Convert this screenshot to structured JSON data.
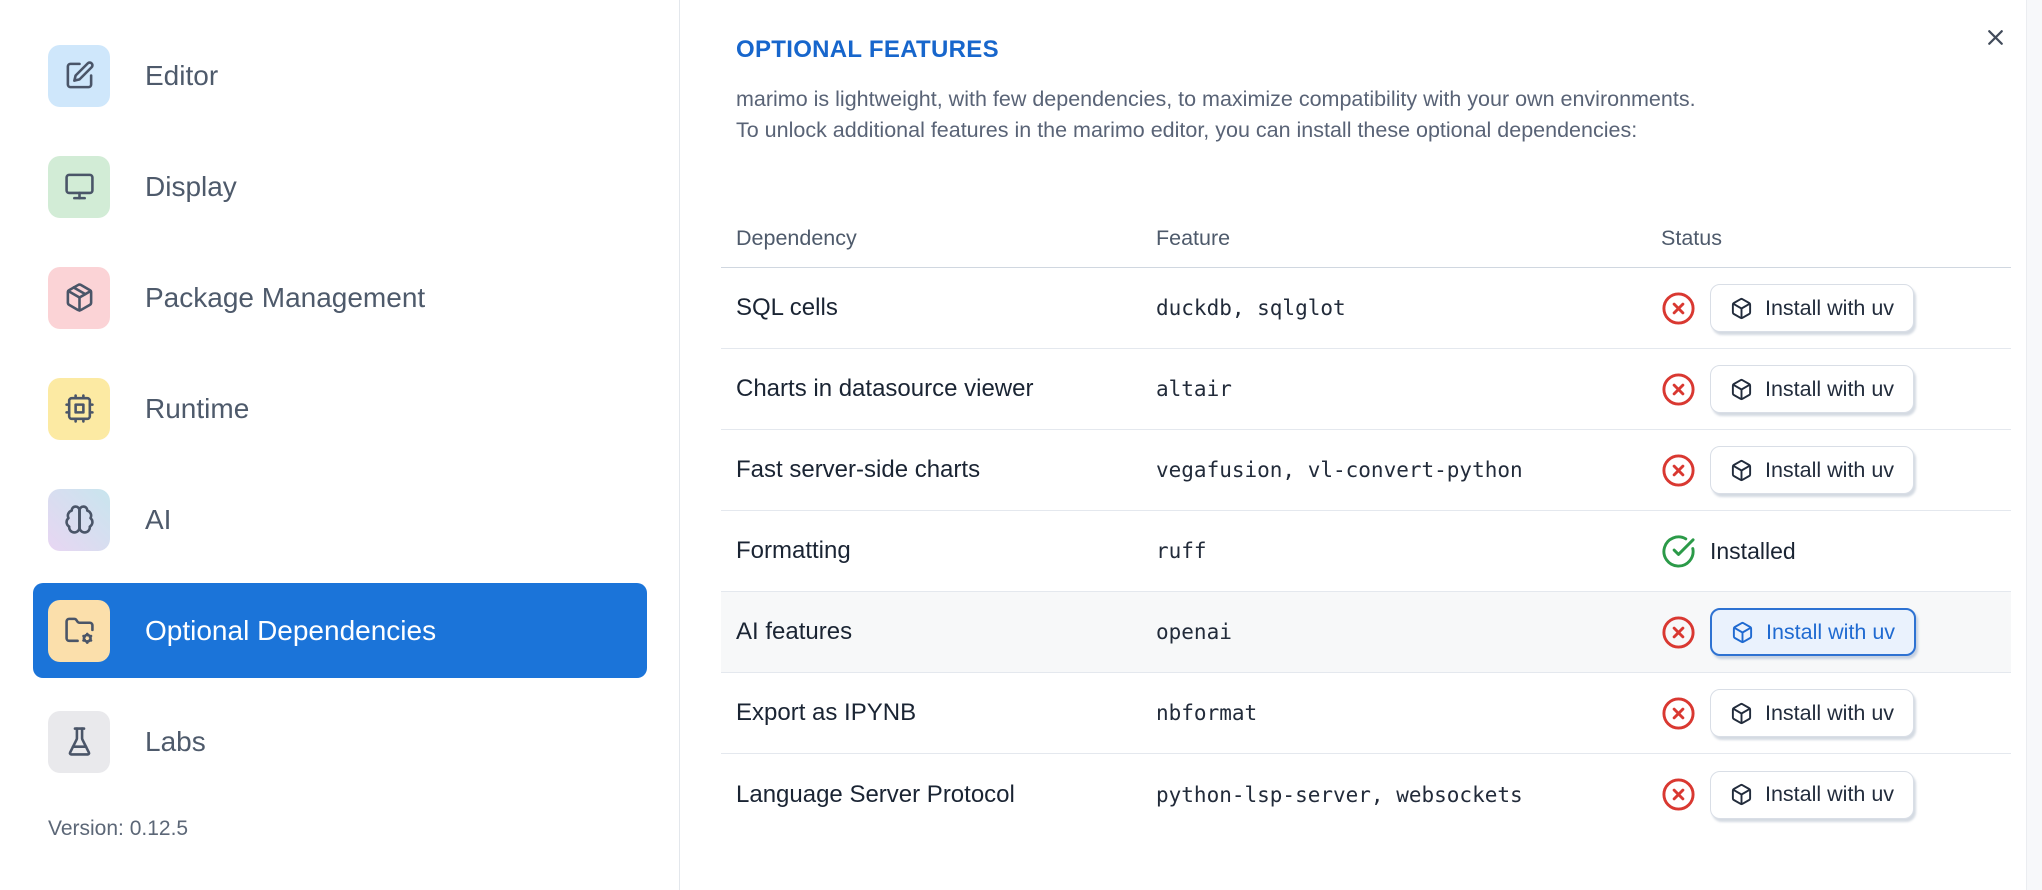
{
  "sidebar": {
    "items": [
      {
        "id": "editor",
        "label": "Editor",
        "icon": "square-pen",
        "icon_bg": "#cfe7fb"
      },
      {
        "id": "display",
        "label": "Display",
        "icon": "monitor",
        "icon_bg": "#d2ecd6"
      },
      {
        "id": "package-management",
        "label": "Package Management",
        "icon": "package",
        "icon_bg": "#fbd3d6"
      },
      {
        "id": "runtime",
        "label": "Runtime",
        "icon": "cpu",
        "icon_bg": "#fceaa3"
      },
      {
        "id": "ai",
        "label": "AI",
        "icon": "brain",
        "icon_bg": "linear-gradient(45deg,#e8d6f2,#c8e5ee)"
      },
      {
        "id": "optional-dependencies",
        "label": "Optional Dependencies",
        "icon": "folder-cog",
        "icon_bg": "#fbdfab",
        "selected": true
      },
      {
        "id": "labs",
        "label": "Labs",
        "icon": "flask",
        "icon_bg": "#e9e9ec"
      }
    ],
    "version_label": "Version: 0.12.5"
  },
  "panel": {
    "title": "OPTIONAL FEATURES",
    "description_line1": "marimo is lightweight, with few dependencies, to maximize compatibility with your own environments.",
    "description_line2": "To unlock additional features in the marimo editor, you can install these optional dependencies:",
    "close_icon": "x"
  },
  "table": {
    "columns": [
      "Dependency",
      "Feature",
      "Status"
    ],
    "install_button_label": "Install with uv",
    "installed_label": "Installed",
    "rows": [
      {
        "dependency": "SQL cells",
        "feature": "duckdb, sqlglot",
        "installed": false
      },
      {
        "dependency": "Charts in datasource viewer",
        "feature": "altair",
        "installed": false
      },
      {
        "dependency": "Fast server-side charts",
        "feature": "vegafusion, vl-convert-python",
        "installed": false
      },
      {
        "dependency": "Formatting",
        "feature": "ruff",
        "installed": true
      },
      {
        "dependency": "AI features",
        "feature": "openai",
        "installed": false,
        "highlighted": true
      },
      {
        "dependency": "Export as IPYNB",
        "feature": "nbformat",
        "installed": false
      },
      {
        "dependency": "Language Server Protocol",
        "feature": "python-lsp-server, websockets",
        "installed": false
      }
    ]
  },
  "colors": {
    "accent_blue": "#1b74d9",
    "title_blue": "#1766cc",
    "status_red": "#d93831",
    "status_green": "#2b9a48",
    "focused_button_bg": "#eaf2fd",
    "focused_button_border": "#2e72d2",
    "focused_button_text": "#1f6ad1",
    "highlight_row_bg": "#f7f8f9"
  }
}
